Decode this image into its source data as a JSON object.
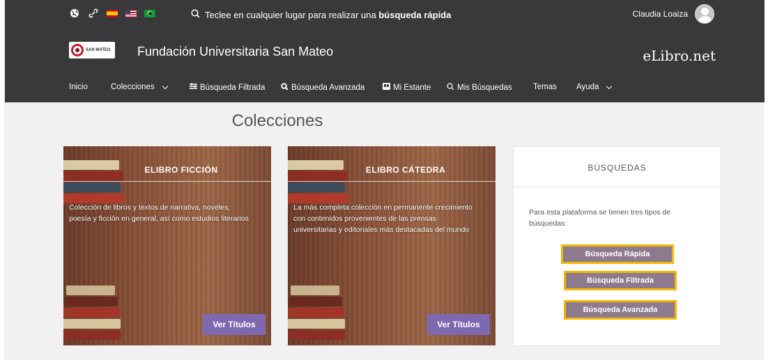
{
  "topbar": {
    "icons": [
      "globe-icon",
      "link-icon",
      "flag-spain-icon",
      "flag-usa-icon",
      "flag-brazil-icon"
    ],
    "search_text": "Teclee en cualquier lugar para realizar una ",
    "search_bold": "búsqueda rápida",
    "user_name": "Claudia Loaiza"
  },
  "brand": {
    "logo_text": "SAN MATEO",
    "org_name": "Fundación Universitaria San Mateo",
    "site_name": "eLibro.net"
  },
  "nav": {
    "items": [
      {
        "label": "Inicio"
      },
      {
        "label": "Colecciones"
      },
      {
        "label": "Búsqueda Filtrada"
      },
      {
        "label": "Búsqueda Avanzada"
      },
      {
        "label": "Mi Estante"
      },
      {
        "label": "Mis Búsquedas"
      },
      {
        "label": "Temas"
      },
      {
        "label": "Ayuda"
      }
    ]
  },
  "main": {
    "title": "Colecciones",
    "cards": [
      {
        "title": "ELIBRO FICCIÓN",
        "description": "Colección de libros y textos de narrativa, noveles, poesía y ficción en general, así como estudios literarios",
        "button": "Ver Títulos"
      },
      {
        "title": "ELIBRO CÁTEDRA",
        "description": "La más completa colección en permanente crecimiento con contenidos provenientes de las prensas universitarias y editoriales más destacadas del mundo",
        "button": "Ver Títulos"
      }
    ],
    "searches": {
      "title": "BÚSQUEDAS",
      "description": "Para esta plataforma se tienen tres tipos de búsquedas:",
      "buttons": [
        "Búsqueda Rápida",
        "Búsqueda Filtrada",
        "Búsqueda Avanzada"
      ]
    }
  },
  "colors": {
    "header_bg": "#39393b",
    "accent_purple": "#7e69b0",
    "highlight_border": "#f2b800",
    "search_button_bg": "#8e7a8e"
  }
}
